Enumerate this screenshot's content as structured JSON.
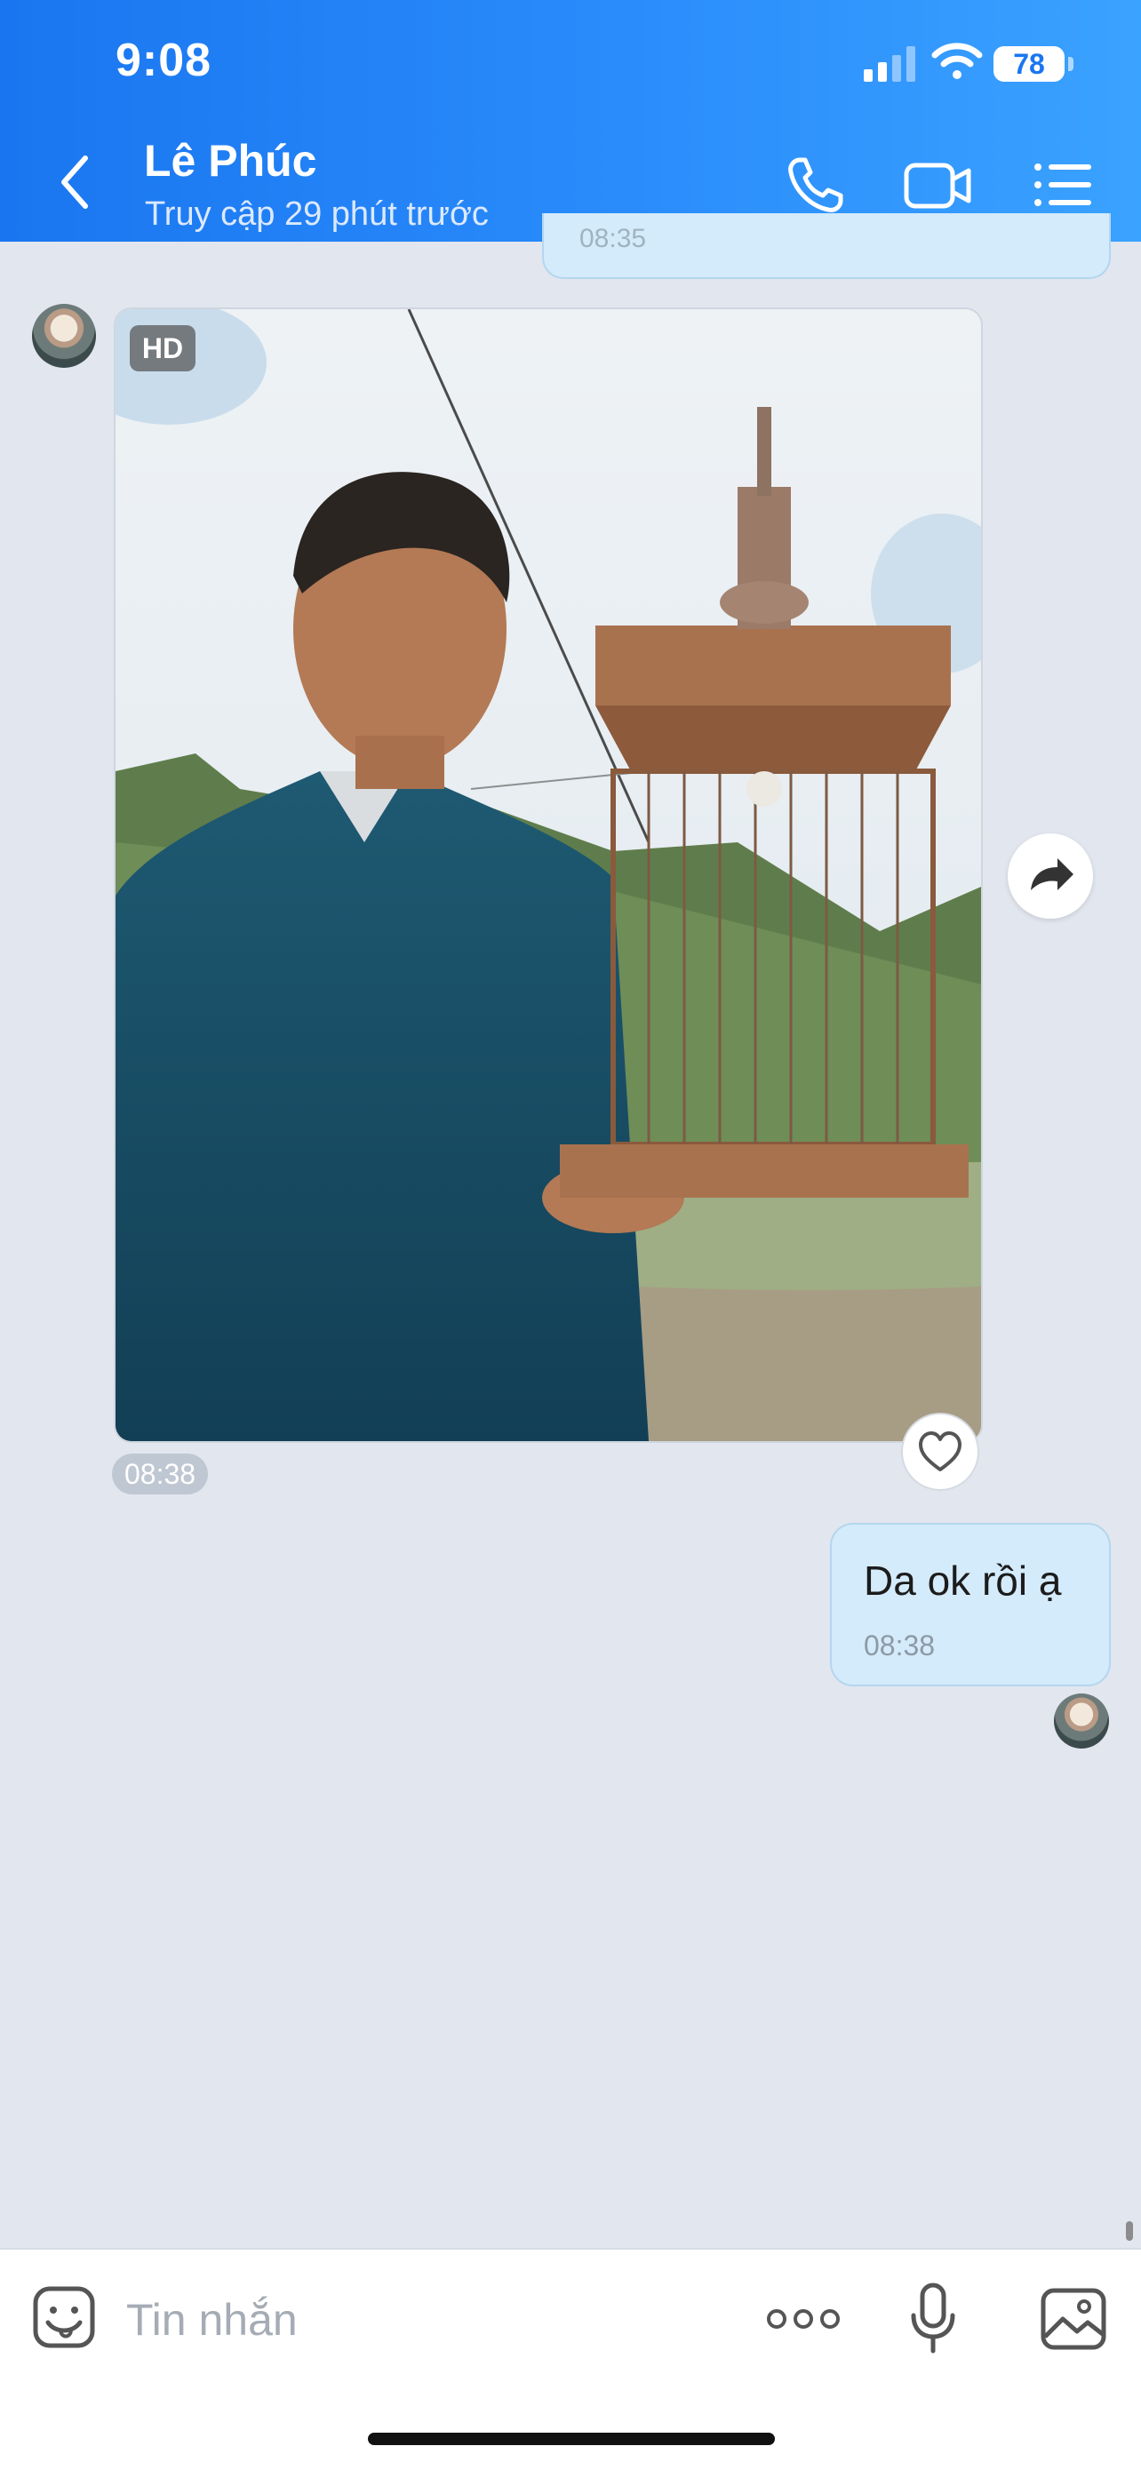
{
  "status_bar": {
    "time": "9:08",
    "battery": "78"
  },
  "header": {
    "contact_name": "Lê Phúc",
    "contact_status": "Truy cập 29 phút trước"
  },
  "messages": {
    "top_partial_time": "08:35",
    "photo": {
      "hd_badge": "HD",
      "time": "08:38"
    },
    "outgoing": {
      "text": "Da ok rồi ạ",
      "time": "08:38"
    }
  },
  "composer": {
    "placeholder": "Tin nhắn"
  },
  "colors": {
    "header_start": "#1a76f0",
    "header_end": "#3aa2ff",
    "outgoing_bubble": "#d4ebfb",
    "chat_background": "#e2e6ee"
  },
  "icons": {
    "back": "chevron-left-icon",
    "call": "phone-icon",
    "video": "video-camera-icon",
    "menu": "list-menu-icon",
    "share": "share-arrow-icon",
    "like": "heart-icon",
    "emoji": "sticker-smile-icon",
    "more": "more-dots-icon",
    "mic": "microphone-icon",
    "gallery": "image-gallery-icon"
  }
}
